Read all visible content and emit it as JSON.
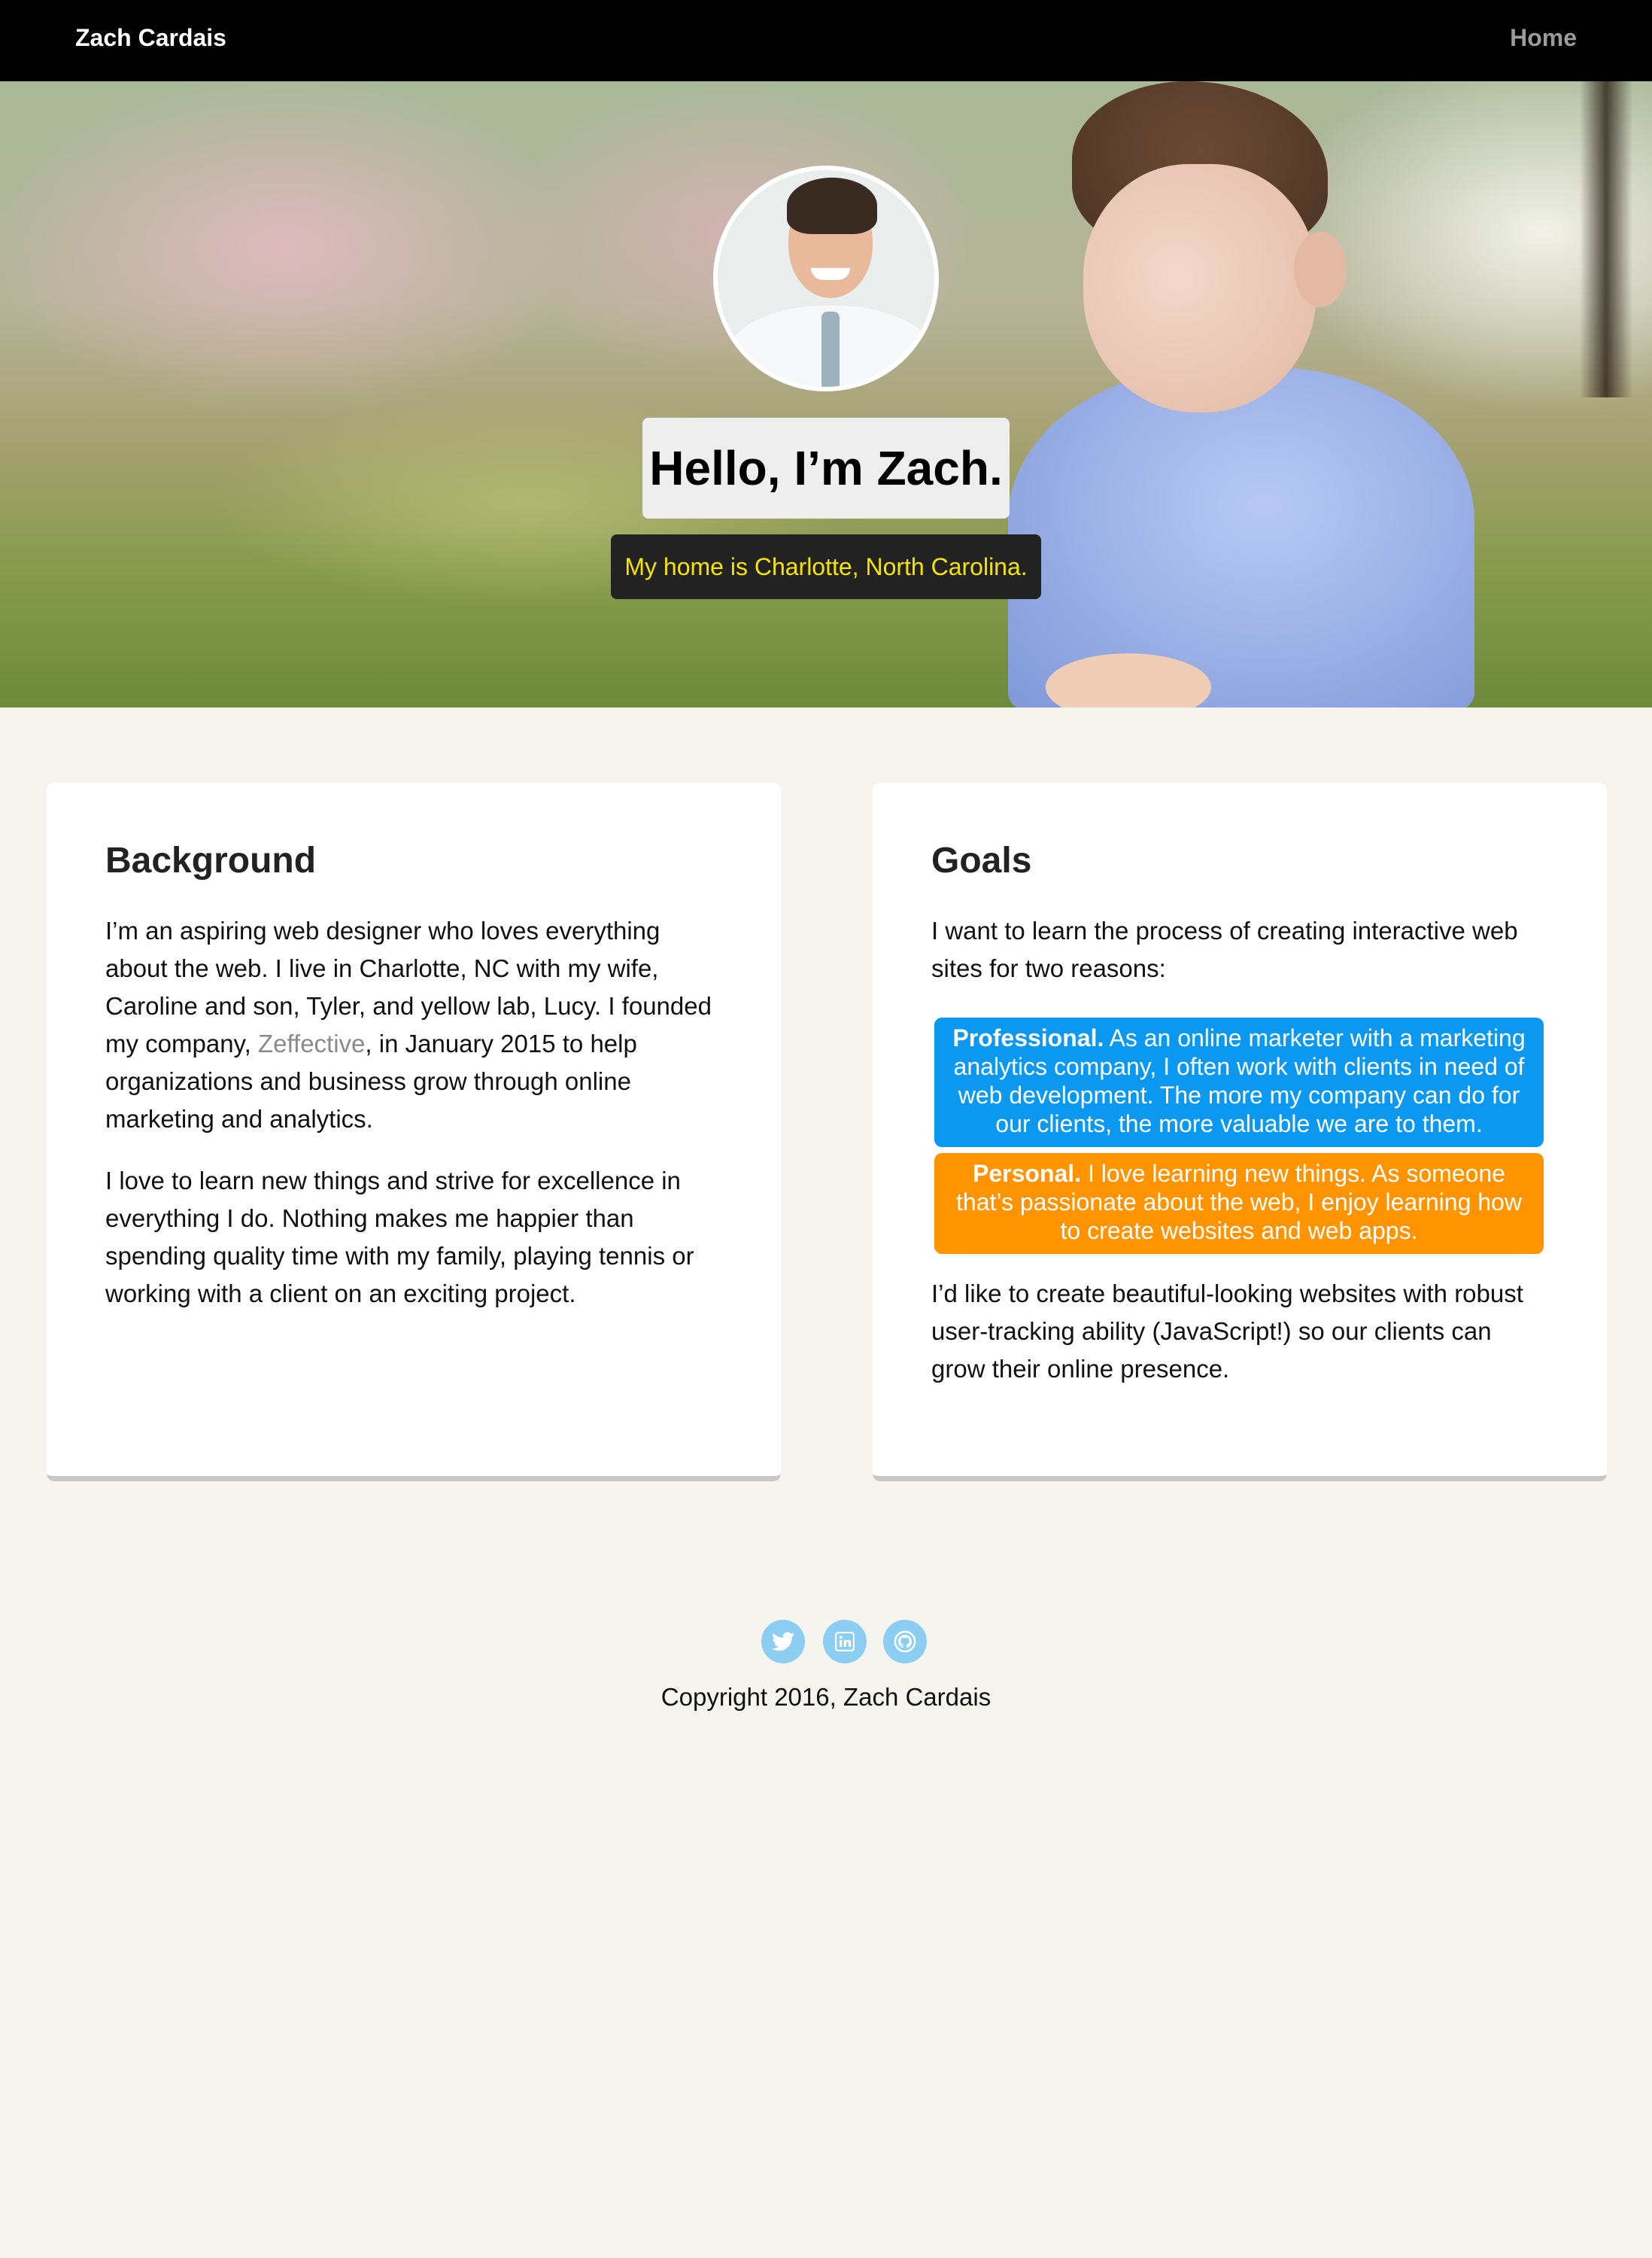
{
  "nav": {
    "brand": "Zach Cardais",
    "home": "Home"
  },
  "hero": {
    "title": "Hello, I’m Zach.",
    "subtitle": "My home is Charlotte, North Carolina."
  },
  "background": {
    "heading": "Background",
    "p1_before": "I’m an aspiring web designer who loves everything about the web. I live in Charlotte, NC with my wife, Caroline and son, Tyler, and yellow lab, Lucy. I founded my company, ",
    "p1_link": "Zeffective",
    "p1_after": ", in January 2015 to help organizations and business grow through online marketing and analytics.",
    "p2": "I love to learn new things and strive for excellence in everything I do. Nothing makes me happier than spending quality time with my family, playing tennis or working with a client on an exciting project."
  },
  "goals": {
    "heading": "Goals",
    "intro": "I want to learn the process of creating interactive web sites for two reasons:",
    "professional_label": "Professional.",
    "professional_text": " As an online marketer with a marketing analytics company, I often work with clients in need of web development. The more my company can do for our clients, the more valuable we are to them.",
    "personal_label": "Personal.",
    "personal_text": " I love learning new things. As someone that’s passionate about the web, I enjoy learning how to create websites and web apps.",
    "closing": "I’d like to create beautiful-looking websites with robust user-tracking ability (JavaScript!) so our clients can grow their online presence."
  },
  "footer": {
    "social_icons": [
      "twitter-icon",
      "linkedin-icon",
      "github-icon"
    ],
    "copyright": "Copyright 2016, Zach Cardais"
  },
  "colors": {
    "nav_bg": "#000000",
    "page_bg": "#f5f4ef",
    "subtitle_text": "#f5e400",
    "professional_bg": "#0b98f1",
    "personal_bg": "#ff9400",
    "social_bg": "#8ccdf2"
  }
}
